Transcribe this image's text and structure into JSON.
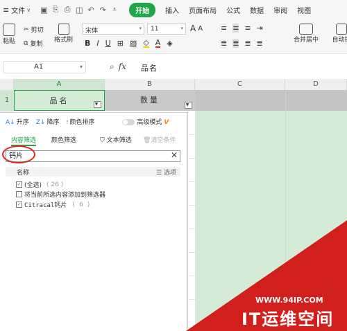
{
  "menubar": {
    "file_label": "文件",
    "tabs": [
      "开始",
      "插入",
      "页面布局",
      "公式",
      "数据",
      "审阅",
      "视图"
    ],
    "active_tab": "开始"
  },
  "ribbon": {
    "paste_label": "粘贴",
    "cut_label": "剪切",
    "copy_label": "复制",
    "format_painter_label": "格式刷",
    "font_name": "宋体",
    "font_size": "11",
    "merge_center_label": "合并居中",
    "auto_wrap_label": "自动换",
    "grow_font": "A",
    "shrink_font": "A"
  },
  "formula_bar": {
    "name_box": "A1",
    "fx_label": "fx",
    "content": "品名"
  },
  "grid": {
    "columns": [
      "A",
      "B",
      "C",
      "D"
    ],
    "row1_number": "1",
    "a1": "品名",
    "b1": "数量"
  },
  "filter_panel": {
    "sort_asc": "升序",
    "sort_desc": "降序",
    "sort_color": "颜色排序",
    "advanced_mode": "高级模式",
    "tab_content": "内容筛选",
    "tab_color": "颜色筛选",
    "text_filter": "文本筛选",
    "clear_condition": "清空条件",
    "search_value": "钙片",
    "list_header_name": "名称",
    "list_header_options": "选项",
    "items": [
      {
        "label": "(全选)",
        "count": "( 26 )",
        "checked": true
      },
      {
        "label": "将当前所选内容添加到筛选器",
        "count": "",
        "checked": false
      },
      {
        "label": "Citracal钙片",
        "count": "( 6 )",
        "checked": true
      }
    ]
  },
  "watermark": {
    "url": "WWW.94IP.COM",
    "name": "IT运维空间"
  },
  "colors": {
    "accent": "#1fa64a",
    "selected_cell": "#d4ecd6",
    "highlight_ring": "#e0271d",
    "watermark_bg": "#d1201c"
  }
}
